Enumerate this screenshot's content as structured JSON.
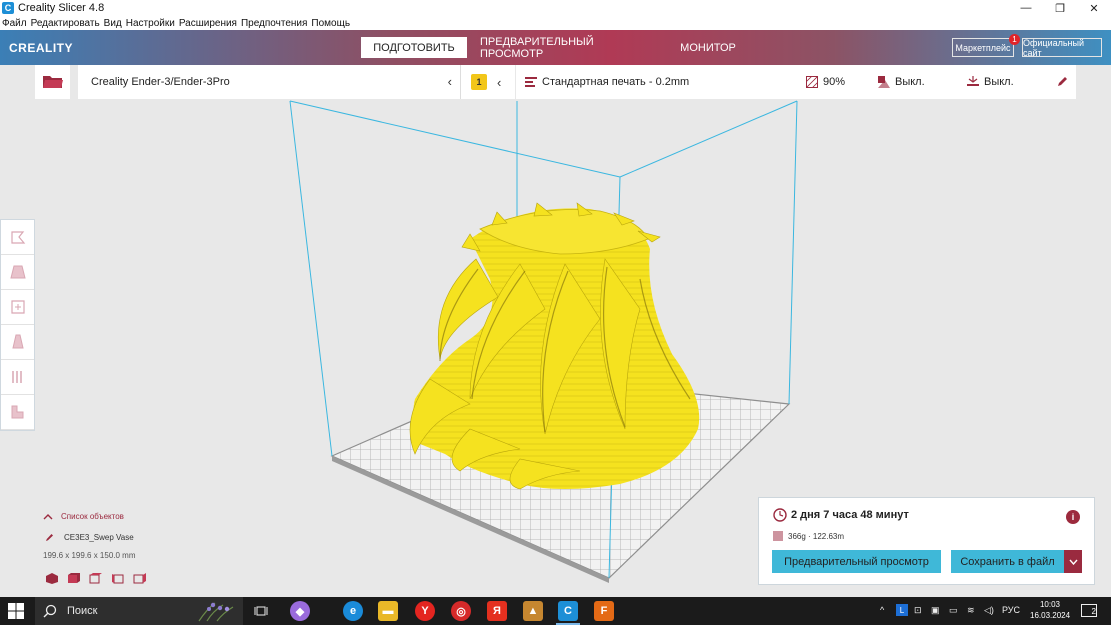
{
  "window": {
    "title": "Creality Slicer 4.8",
    "controls": [
      "—",
      "❐",
      "✕"
    ]
  },
  "menu": [
    "Файл",
    "Редактировать",
    "Вид",
    "Настройки",
    "Расширения",
    "Предпочтения",
    "Помощь"
  ],
  "header": {
    "logo": "CREALITY",
    "tabs": [
      {
        "label": "ПОДГОТОВИТЬ",
        "active": true
      },
      {
        "label": "ПРЕДВАРИТЕЛЬНЫЙ ПРОСМОТР",
        "active": false
      },
      {
        "label": "МОНИТОР",
        "active": false
      }
    ],
    "marketplace_label": "Маркетплейс",
    "marketplace_badge": "1",
    "official_site_label": "Официальный сайт"
  },
  "toolbar": {
    "printer": "Creality Ender-3/Ender-3Pro",
    "warning_count": "1",
    "profile": "Стандартная печать - 0.2mm",
    "infill": "90%",
    "support": "Выкл.",
    "adhesion": "Выкл."
  },
  "left_tools": [
    "move-tool",
    "scale-tool",
    "rotate-tool",
    "mirror-tool",
    "per-model-settings-tool",
    "support-blocker-tool"
  ],
  "objects": {
    "header_label": "Список объектов",
    "item_name": "CE3E3_Swep Vase",
    "dimensions": "199.6 x 199.6 x 150.0 mm"
  },
  "print_info": {
    "time": "2 дня 7 часа 48 минут",
    "usage": "366g · 122.63m",
    "preview_button": "Предварительный просмотр",
    "save_button": "Сохранить в файл"
  },
  "taskbar": {
    "search_placeholder": "Поиск",
    "language": "РУС",
    "time": "10:03",
    "date": "16.03.2024",
    "notifications": "2"
  },
  "colors": {
    "model": "#f5e21f",
    "accent_blue": "#3fb8d8",
    "accent_red": "#9a2a3f",
    "build_volume_line": "#3bb7e0"
  }
}
